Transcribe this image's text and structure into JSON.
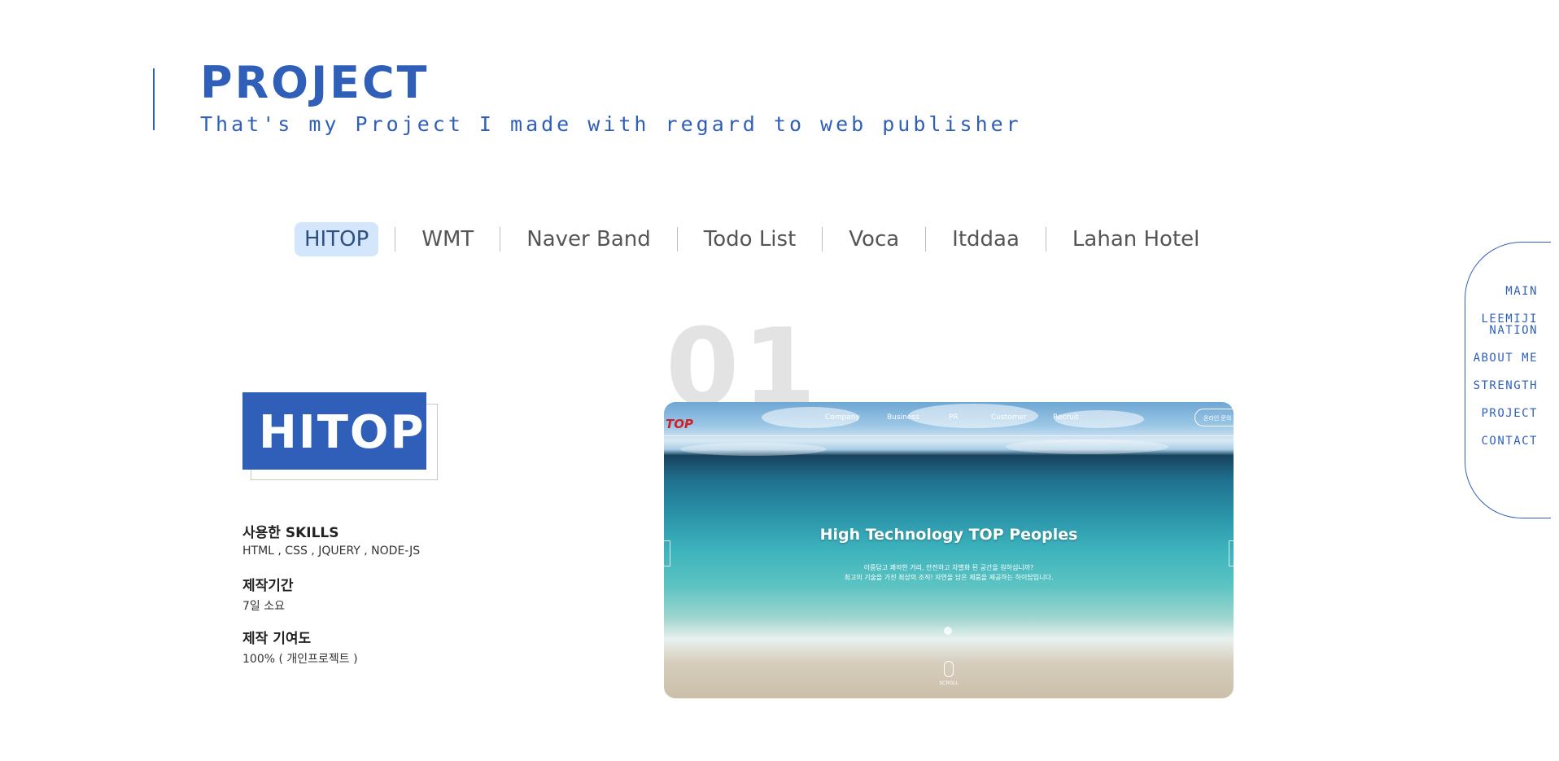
{
  "header": {
    "title": "PROJECT",
    "subtitle": "That's my Project I made with regard to web publisher"
  },
  "tabs": [
    {
      "label": "HITOP",
      "active": true
    },
    {
      "label": "WMT"
    },
    {
      "label": "Naver Band"
    },
    {
      "label": "Todo List"
    },
    {
      "label": "Voca"
    },
    {
      "label": "Itddaa"
    },
    {
      "label": "Lahan Hotel"
    }
  ],
  "project": {
    "number": "01",
    "name": "HITOP",
    "info": [
      {
        "label": "사용한 SKILLS",
        "value": "HTML , CSS , JQUERY , NODE-JS"
      },
      {
        "label": "제작기간",
        "value": "7일 소요"
      },
      {
        "label": "제작 기여도",
        "value": "100% ( 개인프로젝트 )"
      }
    ],
    "preview": {
      "logo": "TOP",
      "nav": [
        "Company",
        "Business",
        "PR",
        "Customer",
        "Recruit"
      ],
      "button": "온라인 문의",
      "headline": "High Technology TOP Peoples",
      "desc": [
        "아름답고 쾌적한 거리, 안전하고 차별화 된 공간을 원하십니까?",
        "최고의 기술을 가진 최상의 조직! 자연을 담은 제품을 제공하는 하이탑입니다."
      ],
      "scroll": "SCROLL"
    }
  },
  "side_nav": {
    "items": [
      "MAIN",
      "LEEMIJI NATION",
      "ABOUT ME",
      "STRENGTH",
      "PROJECT",
      "CONTACT"
    ]
  },
  "colors": {
    "accent": "#2f5fb8",
    "active_tab_bg": "#d4e6fb",
    "big_number": "#e3e3e3"
  }
}
